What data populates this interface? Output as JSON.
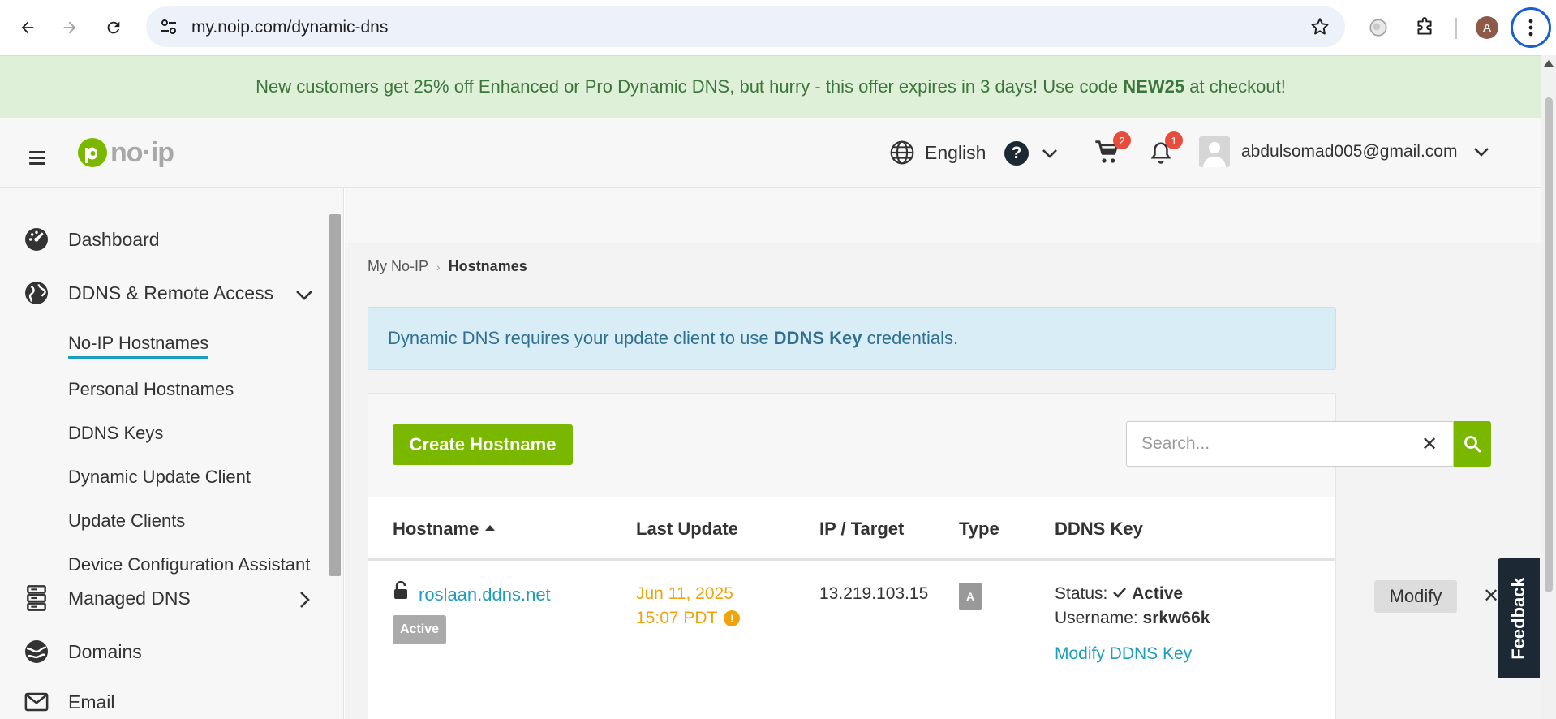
{
  "browser": {
    "url": "my.noip.com/dynamic-dns",
    "profile_initial": "A"
  },
  "promo": {
    "text_before": "New customers get 25% off Enhanced or Pro Dynamic DNS, but hurry - this offer expires in 3 days! Use code ",
    "code": "NEW25",
    "text_after": " at checkout!"
  },
  "header": {
    "logo_text": "no·ip",
    "language": "English",
    "help_symbol": "?",
    "cart_count": "2",
    "notification_count": "1",
    "user_email": "abdulsomad005@gmail.com"
  },
  "sidebar": {
    "dashboard": "Dashboard",
    "ddns": "DDNS & Remote Access",
    "sub_items": [
      "No-IP Hostnames",
      "Personal Hostnames",
      "DDNS Keys",
      "Dynamic Update Client",
      "Update Clients",
      "Device Configuration Assistant"
    ],
    "managed_dns": "Managed DNS",
    "domains": "Domains",
    "email": "Email"
  },
  "breadcrumb": {
    "root": "My No-IP",
    "sep": "›",
    "current": "Hostnames"
  },
  "alert": {
    "before": "Dynamic DNS requires your update client to use ",
    "key": "DDNS Key",
    "after": " credentials."
  },
  "toolbar": {
    "create_label": "Create Hostname",
    "search_placeholder": "Search...",
    "clear_symbol": "✕"
  },
  "table": {
    "headers": {
      "hostname": "Hostname",
      "last_update": "Last Update",
      "ip_target": "IP / Target",
      "type": "Type",
      "ddns_key": "DDNS Key"
    },
    "rows": [
      {
        "hostname": "roslaan.ddns.net",
        "badge": "Active",
        "date": "Jun 11, 2025",
        "time": "15:07 PDT",
        "warn_symbol": "!",
        "ip": "13.219.103.15",
        "type": "A",
        "status_label": "Status:",
        "status_value": "Active",
        "username_label": "Username:",
        "username_value": "srkw66k",
        "modify_key_label": "Modify DDNS Key",
        "modify_label": "Modify",
        "delete_symbol": "✕"
      }
    ]
  },
  "feedback_label": "Feedback",
  "colors": {
    "brand_green": "#7ab800",
    "link_blue": "#1a9ebc",
    "warning_orange": "#f0a30a",
    "promo_bg": "#dff0d8",
    "alert_bg": "#d9edf7"
  }
}
